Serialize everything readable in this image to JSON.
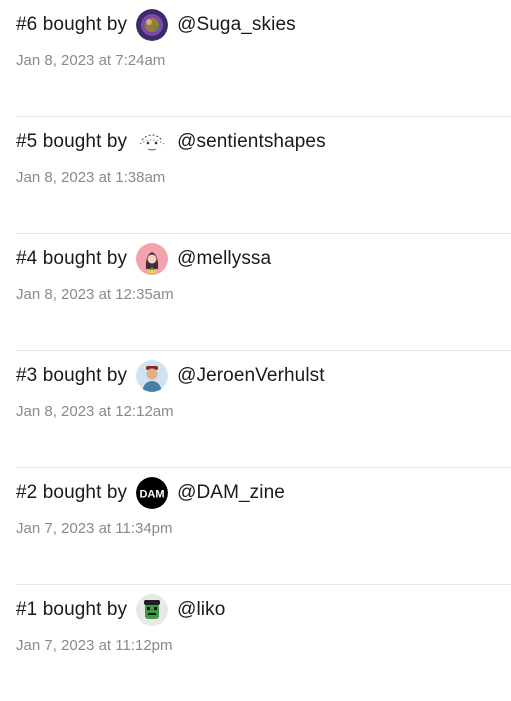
{
  "purchases": [
    {
      "rank": "#6",
      "label": "bought by",
      "handle": "@Suga_skies",
      "date": "Jan 8, 2023 at 7:24am",
      "avatar_icon": "purple-orb-avatar"
    },
    {
      "rank": "#5",
      "label": "bought by",
      "handle": "@sentientshapes",
      "date": "Jan 8, 2023 at 1:38am",
      "avatar_icon": "sketch-face-avatar"
    },
    {
      "rank": "#4",
      "label": "bought by",
      "handle": "@mellyssa",
      "date": "Jan 8, 2023 at 12:35am",
      "avatar_icon": "pink-portrait-avatar"
    },
    {
      "rank": "#3",
      "label": "bought by",
      "handle": "@JeroenVerhulst",
      "date": "Jan 8, 2023 at 12:12am",
      "avatar_icon": "person-photo-avatar"
    },
    {
      "rank": "#2",
      "label": "bought by",
      "handle": "@DAM_zine",
      "date": "Jan 7, 2023 at 11:34pm",
      "avatar_icon": "dam-logo-avatar",
      "avatar_text": "DAM"
    },
    {
      "rank": "#1",
      "label": "bought by",
      "handle": "@liko",
      "date": "Jan 7, 2023 at 11:12pm",
      "avatar_icon": "green-character-avatar"
    }
  ]
}
